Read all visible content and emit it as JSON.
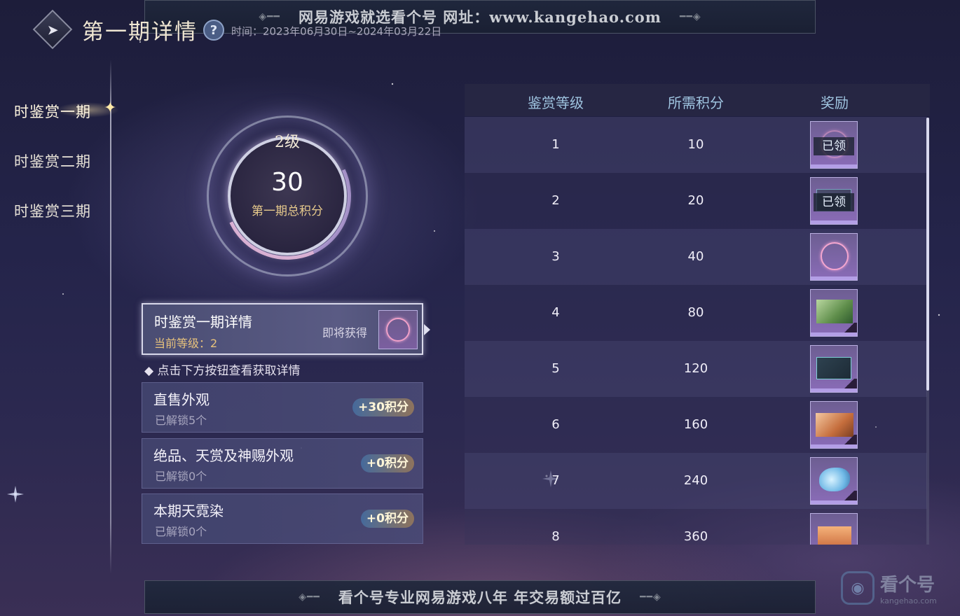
{
  "banners": {
    "top": "网易游戏就选看个号  网址：www.kangehao.com",
    "bottom": "看个号专业网易游戏八年  年交易额过百亿"
  },
  "header": {
    "title": "第一期详情",
    "help_glyph": "?",
    "period": "时间：2023年06月30日~2024年03月22日"
  },
  "sidebar": {
    "items": [
      {
        "label": "时鉴赏一期"
      },
      {
        "label": "时鉴赏二期"
      },
      {
        "label": "时鉴赏三期"
      }
    ]
  },
  "progress": {
    "level": "2级",
    "score": "30",
    "caption": "第一期总积分"
  },
  "detail": {
    "title": "时鉴赏一期详情",
    "current_level": "当前等级：2",
    "upcoming": "即将获得"
  },
  "hint": "点击下方按钮查看获取详情",
  "sources": [
    {
      "title": "直售外观",
      "sub": "已解锁5个",
      "badge": "+30积分"
    },
    {
      "title": "绝品、天赏及神赐外观",
      "sub": "已解锁0个",
      "badge": "+0积分"
    },
    {
      "title": "本期天霓染",
      "sub": "已解锁0个",
      "badge": "+0积分"
    }
  ],
  "table": {
    "headers": {
      "level": "鉴赏等级",
      "points": "所需积分",
      "reward": "奖励"
    },
    "rows": [
      {
        "level": "1",
        "points": "10",
        "reward_icon": "claimed-ring-icon",
        "claimed": "已领"
      },
      {
        "level": "2",
        "points": "20",
        "reward_icon": "claimed-frame-icon",
        "claimed": "已领"
      },
      {
        "level": "3",
        "points": "40",
        "reward_icon": "flower-ring-icon"
      },
      {
        "level": "4",
        "points": "80",
        "reward_icon": "green-landscape-icon"
      },
      {
        "level": "5",
        "points": "120",
        "reward_icon": "dark-frame-icon"
      },
      {
        "level": "6",
        "points": "160",
        "reward_icon": "autumn-card-icon"
      },
      {
        "level": "7",
        "points": "240",
        "reward_icon": "spirit-fish-icon"
      },
      {
        "level": "8",
        "points": "360",
        "reward_icon": "flame-card-icon"
      }
    ]
  },
  "watermark": {
    "name": "看个号",
    "url": "kangehao.com"
  },
  "colors": {
    "accent_gold": "#e6c98c",
    "header_blue": "#9fc4e0",
    "badge_text": "#fff6d8"
  }
}
